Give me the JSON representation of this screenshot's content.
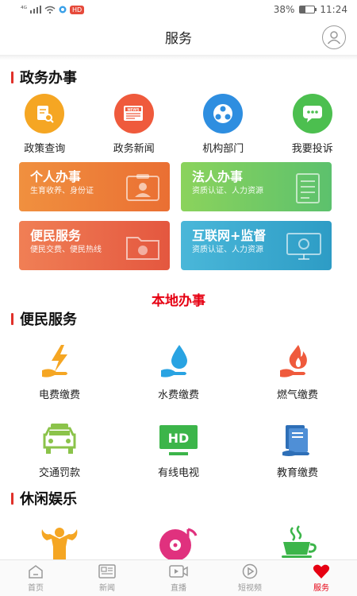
{
  "status_bar": {
    "battery": "38%",
    "time": "11:24",
    "chip": "HD",
    "signal": "⁴ᴳ"
  },
  "header": {
    "title": "服务"
  },
  "sections": {
    "gov": "政务办事",
    "convenience": "便民服务",
    "leisure": "休闲娱乐"
  },
  "gov_items": [
    {
      "label": "政策查询",
      "icon": "document-search-icon",
      "color": "#f5a623"
    },
    {
      "label": "政务新闻",
      "icon": "news-icon",
      "color": "#ef5a3c"
    },
    {
      "label": "机构部门",
      "icon": "organization-icon",
      "color": "#2e8ee0"
    },
    {
      "label": "我要投诉",
      "icon": "chat-icon",
      "color": "#4cbf4f"
    }
  ],
  "cards": [
    {
      "title": "个人办事",
      "sub": "生育收养、身份证"
    },
    {
      "title": "法人办事",
      "sub": "资质认证、人力资源"
    },
    {
      "title": "便民服务",
      "sub": "便民交费、便民热线"
    },
    {
      "title": "互联网+监督",
      "sub": "资质认证、人力资源"
    }
  ],
  "local_label": "本地办事",
  "services": [
    {
      "label": "电费缴费",
      "icon": "electricity-icon"
    },
    {
      "label": "水费缴费",
      "icon": "water-icon"
    },
    {
      "label": "燃气缴费",
      "icon": "gas-flame-icon"
    },
    {
      "label": "交通罚款",
      "icon": "car-icon"
    },
    {
      "label": "有线电视",
      "icon": "tv-icon",
      "tv_text": "HD"
    },
    {
      "label": "教育缴费",
      "icon": "education-icon"
    }
  ],
  "leisure_icons": [
    "fitness-icon",
    "music-icon",
    "tea-icon"
  ],
  "nav": [
    {
      "label": "首页",
      "icon": "home-icon"
    },
    {
      "label": "新闻",
      "icon": "news-nav-icon"
    },
    {
      "label": "直播",
      "icon": "live-icon"
    },
    {
      "label": "短视频",
      "icon": "short-video-icon"
    },
    {
      "label": "服务",
      "icon": "heart-icon",
      "active": true
    }
  ]
}
